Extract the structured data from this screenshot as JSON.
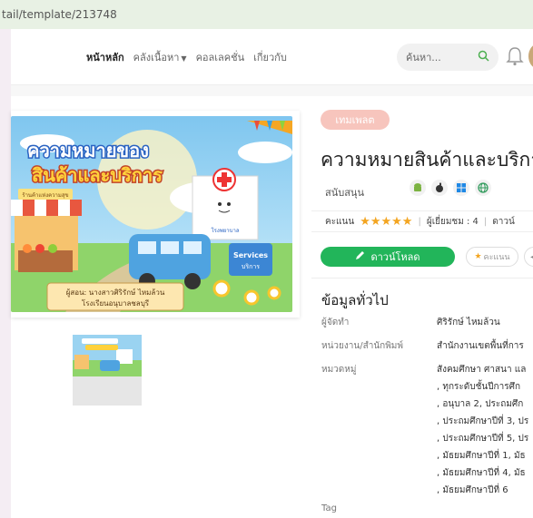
{
  "browser": {
    "url": "tail/template/213748"
  },
  "header": {
    "nav": {
      "home": "หน้าหลัก",
      "library": "คลังเนื้อหา",
      "collections": "คอลเลคชั่น",
      "about": "เกี่ยวกับ"
    },
    "search_placeholder": "ค้นหา..."
  },
  "cover": {
    "title_line1": "ความหมายของ",
    "title_line2": "สินค้าและบริการ",
    "shop_sign": "ร้านค้าแห่งความสุข",
    "hospital_sign": "โรงพยาบาล",
    "services_en": "Services",
    "services_th": "บริการ",
    "author_line1": "ผู้สอน: นางสาวศิริรักษ์ ไหมล้วน",
    "author_line2": "โรงเรียนอนุบาลชลบุรี"
  },
  "detail": {
    "badge": "เทมเพลต",
    "title": "ความหมายสินค้าและบริการ",
    "support_label": "สนับสนุน",
    "rating_label": "คะแนน",
    "stars": "★★★★★",
    "views": "ผู้เยี่ยมชม : 4",
    "downloads": "ดาวน์",
    "download_button": "ดาวน์โหลด",
    "rate_button": "คะแนน"
  },
  "info": {
    "section_title": "ข้อมูลทั่วไป",
    "author_label": "ผู้จัดทำ",
    "author_value": "ศิริรักษ์ ไหมล้วน",
    "agency_label": "หน่วยงาน/สำนักพิมพ์",
    "agency_value": "สำนักงานเขตพื้นที่การ",
    "category_label": "หมวดหมู่",
    "categories": [
      "สังคมศึกษา ศาสนา แล",
      ", ทุกระดับชั้นปีการศึก",
      ", อนุบาล 2, ประถมศึก",
      ", ประถมศึกษาปีที่ 3, ปร",
      ", ประถมศึกษาปีที่ 5, ปร",
      ", มัธยมศึกษาปีที่ 1, มัธ",
      ", มัธยมศึกษาปีที่ 4, มัธ",
      ", มัธยมศึกษาปีที่ 6"
    ],
    "tag_label": "Tag"
  },
  "colors": {
    "accent_green": "#22b55a",
    "badge_pink": "#f7c5bd",
    "star": "#f3a521"
  }
}
